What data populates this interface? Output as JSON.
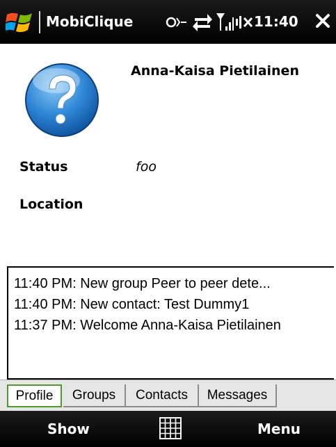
{
  "titlebar": {
    "app_title": "MobiClique",
    "time": "11:40",
    "icons": [
      "windows-flag-icon",
      "connectivity-icon",
      "data-transfer-icon",
      "signal-strength-icon",
      "volume-muted-icon",
      "close-icon"
    ]
  },
  "profile": {
    "avatar_icon": "question-mark-icon",
    "name": "Anna-Kaisa Pietilainen",
    "status_label": "Status",
    "status_value": "foo",
    "location_label": "Location",
    "location_value": ""
  },
  "log": {
    "entries": [
      "11:40 PM: New group Peer to peer dete...",
      "11:40 PM: New contact: Test Dummy1",
      "11:37 PM: Welcome Anna-Kaisa Pietilainen"
    ]
  },
  "tabs": [
    {
      "label": "Profile",
      "active": true
    },
    {
      "label": "Groups",
      "active": false
    },
    {
      "label": "Contacts",
      "active": false
    },
    {
      "label": "Messages",
      "active": false
    }
  ],
  "softkeys": {
    "left": "Show",
    "center_icon": "keyboard-icon",
    "right": "Menu"
  },
  "colors": {
    "active_tab_border": "#4a9a2e",
    "bar_background": "#000000",
    "avatar_blue": "#2f86d6"
  }
}
